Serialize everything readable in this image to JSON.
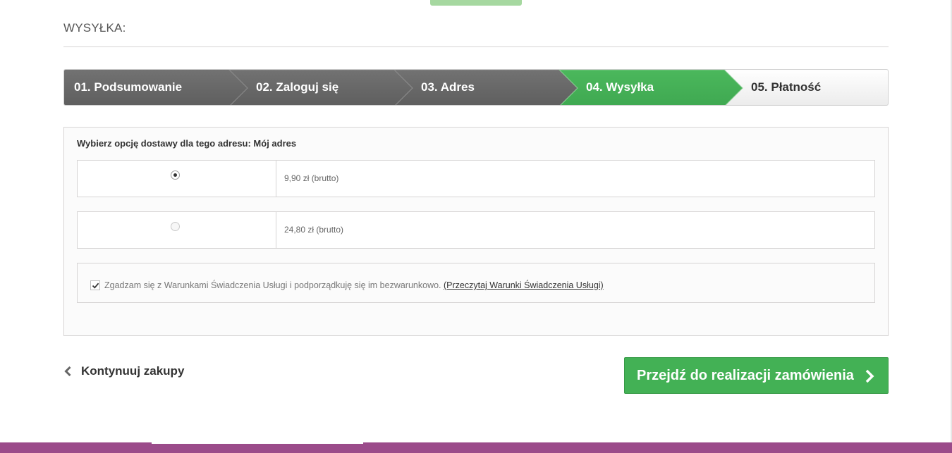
{
  "page": {
    "heading": "WYSYŁKA:"
  },
  "steps": [
    {
      "label": "01. Podsumowanie",
      "state": "done"
    },
    {
      "label": "02. Zaloguj się",
      "state": "done"
    },
    {
      "label": "03. Adres",
      "state": "done"
    },
    {
      "label": "04. Wysyłka",
      "state": "current"
    },
    {
      "label": "05. Płatność",
      "state": "todo"
    }
  ],
  "delivery": {
    "title": "Wybierz opcję dostawy dla tego adresu: Mój adres",
    "options": [
      {
        "price": "9,90 zł (brutto)",
        "selected": true
      },
      {
        "price": "24,80 zł (brutto)",
        "selected": false
      }
    ],
    "terms": {
      "checked": true,
      "text": "Zgadzam się z Warunkami Świadczenia Usługi i podporządkuję się im bezwarunkowo.",
      "link": "(Przeczytaj Warunki Świadczenia Usługi)"
    }
  },
  "actions": {
    "continue_label": "Kontynuuj zakupy",
    "proceed_label": "Przejdź do realizacji zamówienia"
  },
  "colors": {
    "step_done": "#666666",
    "step_current": "#43b155",
    "accent_green": "#43b155",
    "footer": "#9b4b8a"
  },
  "icons": {
    "continue": "chevron-left-icon",
    "proceed": "chevron-right-icon",
    "terms_checkbox": "check-icon"
  }
}
